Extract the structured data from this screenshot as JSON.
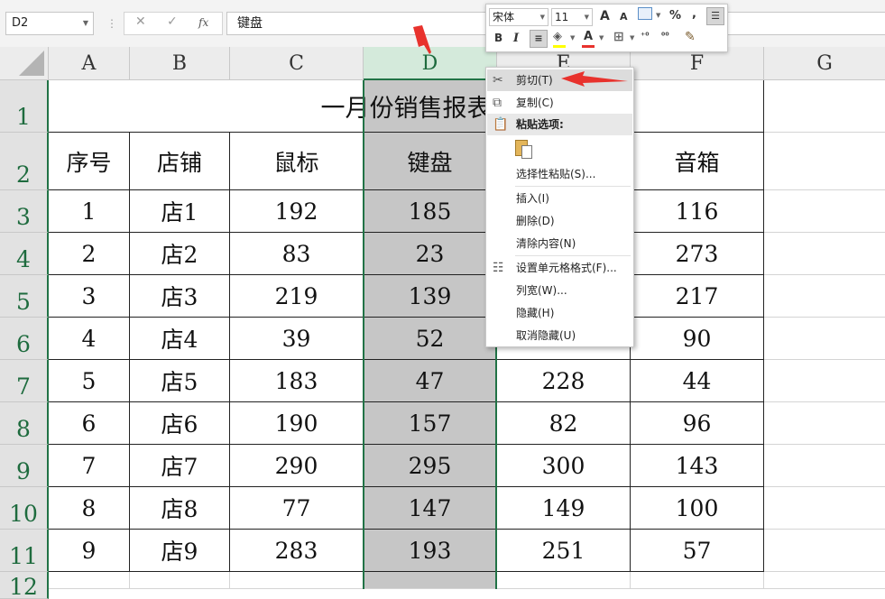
{
  "formula_bar": {
    "name_box": "D2",
    "cancel_icon": "✕",
    "enter_icon": "✓",
    "fx_label": "fx",
    "content": "键盘"
  },
  "columns": [
    "A",
    "B",
    "C",
    "D",
    "E",
    "F",
    "G"
  ],
  "rows": [
    "1",
    "2",
    "3",
    "4",
    "5",
    "6",
    "7",
    "8",
    "9",
    "10",
    "11",
    "12"
  ],
  "selected_column": "D",
  "sheet": {
    "title": "一月份销售报表",
    "headers": [
      "序号",
      "店铺",
      "鼠标",
      "键盘",
      "",
      "音箱"
    ],
    "data": [
      [
        "1",
        "店1",
        "192",
        "185",
        "",
        "116"
      ],
      [
        "2",
        "店2",
        "83",
        "23",
        "",
        "273"
      ],
      [
        "3",
        "店3",
        "219",
        "139",
        "",
        "217"
      ],
      [
        "4",
        "店4",
        "39",
        "52",
        "",
        "90"
      ],
      [
        "5",
        "店5",
        "183",
        "47",
        "228",
        "44"
      ],
      [
        "6",
        "店6",
        "190",
        "157",
        "82",
        "96"
      ],
      [
        "7",
        "店7",
        "290",
        "295",
        "300",
        "143"
      ],
      [
        "8",
        "店8",
        "77",
        "147",
        "149",
        "100"
      ],
      [
        "9",
        "店9",
        "283",
        "193",
        "251",
        "57"
      ]
    ]
  },
  "mini_toolbar": {
    "font_name": "宋体",
    "font_size": "11",
    "grow_font": "A",
    "shrink_font": "A",
    "percent": "%",
    "comma": ",",
    "bold": "B",
    "italic": "I",
    "font_color": "A"
  },
  "context_menu": {
    "items": [
      {
        "label": "剪切(T)",
        "icon": "scissors-icon"
      },
      {
        "label": "复制(C)",
        "icon": "copy-icon"
      },
      {
        "label": "粘贴选项:",
        "icon": "paste-icon"
      },
      {
        "label": "选择性粘贴(S)..."
      },
      {
        "label": "插入(I)"
      },
      {
        "label": "删除(D)"
      },
      {
        "label": "清除内容(N)"
      },
      {
        "label": "设置单元格格式(F)...",
        "icon": "format-cells-icon"
      },
      {
        "label": "列宽(W)..."
      },
      {
        "label": "隐藏(H)"
      },
      {
        "label": "取消隐藏(U)"
      }
    ]
  },
  "annotation_color": "#e8322d",
  "accent_color": "#217346"
}
